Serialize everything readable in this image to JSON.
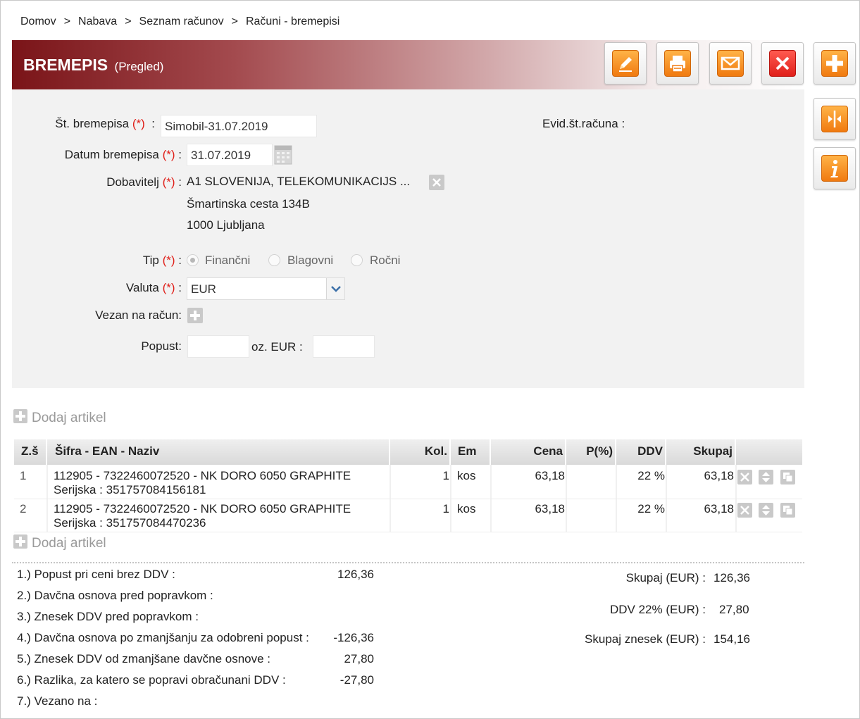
{
  "breadcrumb": [
    "Domov",
    "Nabava",
    "Seznam računov",
    "Računi - bremepisi"
  ],
  "breadcrumb_separator": ">",
  "header": {
    "title": "BREMEPIS",
    "subtitle": "(Pregled)",
    "gradient_start": "#7a1418"
  },
  "toolbar": {
    "edit_icon": "pencil-icon",
    "print_icon": "printer-icon",
    "email_icon": "envelope-icon",
    "delete_icon": "close-icon",
    "add_icon": "plus-icon",
    "split_icon": "split-icon",
    "info_icon": "info-icon",
    "accent": "#f07a10",
    "danger": "#e0201a"
  },
  "form": {
    "required_mark": "(*)",
    "st_bremepisa": {
      "label": "Št. bremepisa",
      "value": "Simobil-31.07.2019"
    },
    "evid_st_racuna": {
      "label": "Evid.št.računa :"
    },
    "datum": {
      "label": "Datum bremepisa",
      "value": "31.07.2019"
    },
    "dobavitelj": {
      "label": "Dobavitelj",
      "name": "A1 SLOVENIJA, TELEKOMUNIKACIJS ...",
      "street": "Šmartinska cesta 134B",
      "city": "1000 Ljubljana"
    },
    "tip": {
      "label": "Tip",
      "options": [
        "Finančni",
        "Blagovni",
        "Ročni"
      ],
      "selected": "Finančni"
    },
    "valuta": {
      "label": "Valuta",
      "value": "EUR"
    },
    "vezan": {
      "label": "Vezan na račun:"
    },
    "popust": {
      "label": "Popust:",
      "value": "",
      "oz_label": "oz. EUR :",
      "eur_value": ""
    }
  },
  "add_item_label": "Dodaj artikel",
  "table": {
    "columns": [
      "Z.š",
      "Šifra - EAN - Naziv",
      "Kol.",
      "Em",
      "Cena",
      "P(%)",
      "DDV",
      "Skupaj"
    ],
    "rows": [
      {
        "zs": "1",
        "naziv": "112905 - 7322460072520 - NK DORO 6050 GRAPHITE",
        "serijska": "Serijska : 351757084156181",
        "kol": "1",
        "em": "kos",
        "cena": "63,18",
        "p": "",
        "ddv": "22 %",
        "skupaj": "63,18"
      },
      {
        "zs": "2",
        "naziv": "112905 - 7322460072520 - NK DORO 6050 GRAPHITE",
        "serijska": "Serijska : 351757084470236",
        "kol": "1",
        "em": "kos",
        "cena": "63,18",
        "p": "",
        "ddv": "22 %",
        "skupaj": "63,18"
      }
    ]
  },
  "summary_left": [
    {
      "label": "1.) Popust pri ceni brez DDV :",
      "value": "126,36"
    },
    {
      "label": "2.) Davčna osnova pred popravkom :",
      "value": ""
    },
    {
      "label": "3.) Znesek DDV pred popravkom :",
      "value": ""
    },
    {
      "label": "4.) Davčna osnova po zmanjšanju za odobreni popust :",
      "value": "-126,36"
    },
    {
      "label": "5.) Znesek DDV od zmanjšane davčne osnove :",
      "value": "27,80"
    },
    {
      "label": "6.) Razlika, za katero se popravi obračunani DDV :",
      "value": "-27,80"
    },
    {
      "label": "7.) Vezano na :",
      "value": ""
    }
  ],
  "summary_right": [
    {
      "label": "Skupaj (EUR) :",
      "value": "126,36"
    },
    {
      "label": "DDV 22% (EUR) :",
      "value": "27,80"
    },
    {
      "label": "Skupaj znesek (EUR) :",
      "value": "154,16"
    }
  ]
}
